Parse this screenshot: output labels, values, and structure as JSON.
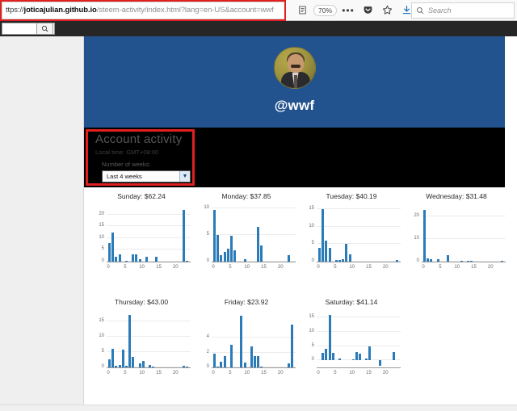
{
  "browser": {
    "url_prefix": "ttps://",
    "url_host": "joticajulian.github.io",
    "url_path": "/steem-activity/index.html?lang=en-US&account=wwf",
    "zoom_level": "70%",
    "reader_icon": "reader-mode-icon",
    "overflow_icon": "more-options-icon",
    "pocket_icon": "pocket-icon",
    "bookmark_icon": "star-icon",
    "download_icon": "download-icon",
    "search_placeholder": "Search",
    "search_icon": "search-icon",
    "find_icon": "search-icon"
  },
  "profile": {
    "handle": "@wwf",
    "avatar_name": "user-avatar"
  },
  "panel": {
    "title": "Account activity",
    "local_time": "Local time: GMT+08:00",
    "weeks_label": "Number of weeks:",
    "weeks_value": "Last 4 weeks",
    "weeks_options": [
      "Last 4 weeks"
    ],
    "dropdown_icon": "chevron-down-icon"
  },
  "colors": {
    "banner_blue": "#23538e",
    "panel_black": "#000000",
    "bar_blue": "#2b7bb9",
    "highlight_red": "#e02020"
  },
  "chart_data": [
    {
      "type": "bar",
      "title": "Sunday: $62.24",
      "day": "Sunday",
      "total": "$62.24",
      "xlabel": "",
      "ylabel": "",
      "xticks": [
        0,
        5,
        10,
        15,
        20
      ],
      "yticks": [
        0,
        5,
        10,
        15,
        20
      ],
      "ylim": [
        0,
        23
      ],
      "x": [
        0,
        1,
        2,
        3,
        4,
        5,
        6,
        7,
        8,
        9,
        10,
        11,
        12,
        13,
        14,
        15,
        16,
        17,
        18,
        19,
        20,
        21,
        22,
        23
      ],
      "values": [
        8,
        12.5,
        2,
        3,
        0,
        0.5,
        0,
        3,
        3,
        1,
        0,
        2,
        0,
        0,
        2,
        0,
        0,
        0,
        0,
        0,
        0,
        0,
        22,
        0.5
      ]
    },
    {
      "type": "bar",
      "title": "Monday: $37.85",
      "day": "Monday",
      "total": "$37.85",
      "xlabel": "",
      "ylabel": "",
      "xticks": [
        0,
        5,
        10,
        15,
        20
      ],
      "yticks": [
        0,
        5,
        10
      ],
      "ylim": [
        0,
        10.2
      ],
      "x": [
        0,
        1,
        2,
        3,
        4,
        5,
        6,
        7,
        8,
        9,
        10,
        11,
        12,
        13,
        14,
        15,
        16,
        17,
        18,
        19,
        20,
        21,
        22,
        23
      ],
      "values": [
        9.7,
        5,
        1.2,
        1.8,
        2.5,
        4.8,
        2.2,
        0,
        0,
        0.5,
        0,
        0,
        0,
        6.5,
        3,
        0,
        0,
        0,
        0,
        0,
        0,
        0,
        1.2,
        0
      ]
    },
    {
      "type": "bar",
      "title": "Tuesday: $40.19",
      "day": "Tuesday",
      "total": "$40.19",
      "xlabel": "",
      "ylabel": "",
      "xticks": [
        0,
        5,
        10,
        15,
        20
      ],
      "yticks": [
        0,
        5,
        10,
        15
      ],
      "ylim": [
        0,
        15.5
      ],
      "x": [
        0,
        1,
        2,
        3,
        4,
        5,
        6,
        7,
        8,
        9,
        10,
        11,
        12,
        13,
        14,
        15,
        16,
        17,
        18,
        19,
        20,
        21,
        22,
        23
      ],
      "values": [
        4,
        15,
        6,
        4,
        0,
        0.4,
        0.4,
        0.7,
        5,
        2.2,
        0,
        0,
        0,
        0,
        0,
        0,
        0,
        0,
        0,
        0,
        0,
        0,
        0,
        0.5
      ]
    },
    {
      "type": "bar",
      "title": "Wednesday: $31.48",
      "day": "Wednesday",
      "total": "$31.48",
      "xlabel": "",
      "ylabel": "",
      "xticks": [
        0,
        5,
        10,
        15,
        20
      ],
      "yticks": [
        0,
        10,
        20
      ],
      "ylim": [
        0,
        24
      ],
      "x": [
        0,
        1,
        2,
        3,
        4,
        5,
        6,
        7,
        8,
        9,
        10,
        11,
        12,
        13,
        14,
        15,
        16,
        17,
        18,
        19,
        20,
        21,
        22,
        23
      ],
      "values": [
        23,
        1.5,
        1,
        0,
        1.2,
        0,
        0,
        3,
        0,
        0,
        0,
        0.3,
        0,
        0.5,
        0.3,
        0,
        0,
        0,
        0,
        0,
        0,
        0,
        0,
        0.2
      ]
    },
    {
      "type": "bar",
      "title": "Thursday: $43.00",
      "day": "Thursday",
      "total": "$43.00",
      "xlabel": "",
      "ylabel": "",
      "xticks": [
        0,
        5,
        10,
        15,
        20
      ],
      "yticks": [
        0,
        5,
        10,
        15
      ],
      "ylim": [
        0,
        17.5
      ],
      "x": [
        0,
        1,
        2,
        3,
        4,
        5,
        6,
        7,
        8,
        9,
        10,
        11,
        12,
        13,
        14,
        15,
        16,
        17,
        18,
        19,
        20,
        21,
        22,
        23
      ],
      "values": [
        2.5,
        6,
        0.4,
        0.8,
        5.8,
        0.5,
        17,
        3.5,
        0,
        1.3,
        2,
        0,
        0.8,
        0.3,
        0,
        0,
        0,
        0,
        0,
        0,
        0,
        0,
        0.4,
        0.2
      ]
    },
    {
      "type": "bar",
      "title": "Friday: $23.92",
      "day": "Friday",
      "total": "$23.92",
      "xlabel": "",
      "ylabel": "",
      "xticks": [
        0,
        5,
        10,
        15,
        20
      ],
      "yticks": [
        0,
        2,
        4
      ],
      "ylim": [
        0,
        7.3
      ],
      "x": [
        0,
        1,
        2,
        3,
        4,
        5,
        6,
        7,
        8,
        9,
        10,
        11,
        12,
        13,
        14,
        15,
        16,
        17,
        18,
        19,
        20,
        21,
        22,
        23
      ],
      "values": [
        1.9,
        0.1,
        0.8,
        1.5,
        0,
        3,
        0,
        0,
        7,
        0.7,
        0,
        2.8,
        1.5,
        1.5,
        0.1,
        0,
        0,
        0,
        0,
        0,
        0,
        0,
        0.5,
        5.8
      ]
    },
    {
      "type": "bar",
      "title": "Saturday: $41.14",
      "day": "Saturday",
      "total": "$41.14",
      "xlabel": "",
      "ylabel": "",
      "xticks": [
        0,
        5,
        10,
        15,
        20
      ],
      "yticks": [
        0,
        5,
        10,
        15
      ],
      "ylim": [
        -2.5,
        16.5
      ],
      "x": [
        0,
        1,
        2,
        3,
        4,
        5,
        6,
        7,
        8,
        9,
        10,
        11,
        12,
        13,
        14,
        15,
        16,
        17,
        18,
        19,
        20,
        21,
        22,
        23
      ],
      "values": [
        0,
        2.5,
        4,
        16,
        2.5,
        0,
        0.5,
        0,
        0,
        0,
        0.3,
        3,
        2.2,
        0,
        0.7,
        5,
        0,
        0,
        -2,
        0,
        0,
        0,
        3,
        0
      ]
    }
  ]
}
